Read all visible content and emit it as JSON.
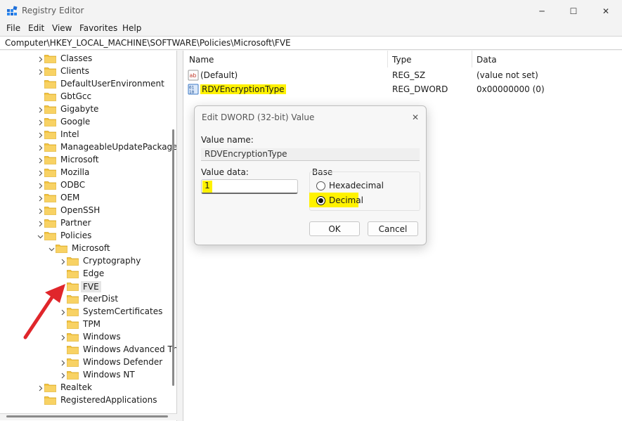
{
  "window": {
    "title": "Registry Editor",
    "controls": {
      "minimize": "─",
      "maximize": "☐",
      "close": "✕"
    }
  },
  "menu": [
    "File",
    "Edit",
    "View",
    "Favorites",
    "Help"
  ],
  "address": "Computer\\HKEY_LOCAL_MACHINE\\SOFTWARE\\Policies\\Microsoft\\FVE",
  "tree": {
    "items": [
      {
        "label": "Classes",
        "expander": ">"
      },
      {
        "label": "Clients",
        "expander": ">"
      },
      {
        "label": "DefaultUserEnvironment",
        "expander": ""
      },
      {
        "label": "GbtGcc",
        "expander": ""
      },
      {
        "label": "Gigabyte",
        "expander": ">"
      },
      {
        "label": "Google",
        "expander": ">"
      },
      {
        "label": "Intel",
        "expander": ">"
      },
      {
        "label": "ManageableUpdatePackage",
        "expander": ">"
      },
      {
        "label": "Microsoft",
        "expander": ">"
      },
      {
        "label": "Mozilla",
        "expander": ">"
      },
      {
        "label": "ODBC",
        "expander": ">"
      },
      {
        "label": "OEM",
        "expander": ">"
      },
      {
        "label": "OpenSSH",
        "expander": ">"
      },
      {
        "label": "Partner",
        "expander": ">"
      },
      {
        "label": "Policies",
        "expander": "v"
      },
      {
        "label": "Microsoft",
        "expander": "v"
      },
      {
        "label": "Cryptography",
        "expander": ">"
      },
      {
        "label": "Edge",
        "expander": ""
      },
      {
        "label": "FVE",
        "expander": ""
      },
      {
        "label": "PeerDist",
        "expander": ""
      },
      {
        "label": "SystemCertificates",
        "expander": ">"
      },
      {
        "label": "TPM",
        "expander": ""
      },
      {
        "label": "Windows",
        "expander": ">"
      },
      {
        "label": "Windows Advanced Th",
        "expander": ""
      },
      {
        "label": "Windows Defender",
        "expander": ">"
      },
      {
        "label": "Windows NT",
        "expander": ">"
      },
      {
        "label": "Realtek",
        "expander": ">"
      },
      {
        "label": "RegisteredApplications",
        "expander": ""
      }
    ]
  },
  "values_pane": {
    "columns": [
      "Name",
      "Type",
      "Data"
    ],
    "rows": [
      {
        "name": "(Default)",
        "type": "REG_SZ",
        "data": "(value not set)",
        "icon": "string-value-icon"
      },
      {
        "name": "RDVEncryptionType",
        "type": "REG_DWORD",
        "data": "0x00000000 (0)",
        "icon": "dword-value-icon"
      }
    ]
  },
  "dialog": {
    "title": "Edit DWORD (32-bit) Value",
    "close": "✕",
    "value_name_label": "Value name:",
    "value_name": "RDVEncryptionType",
    "value_data_label": "Value data:",
    "value_data": "1",
    "base_label": "Base",
    "radio_hex": "Hexadecimal",
    "radio_dec": "Decimal",
    "selected_base": "Decimal",
    "ok": "OK",
    "cancel": "Cancel"
  },
  "colors": {
    "highlight": "#fff200",
    "folder": "#f4c542",
    "arrow": "#e0262b"
  }
}
